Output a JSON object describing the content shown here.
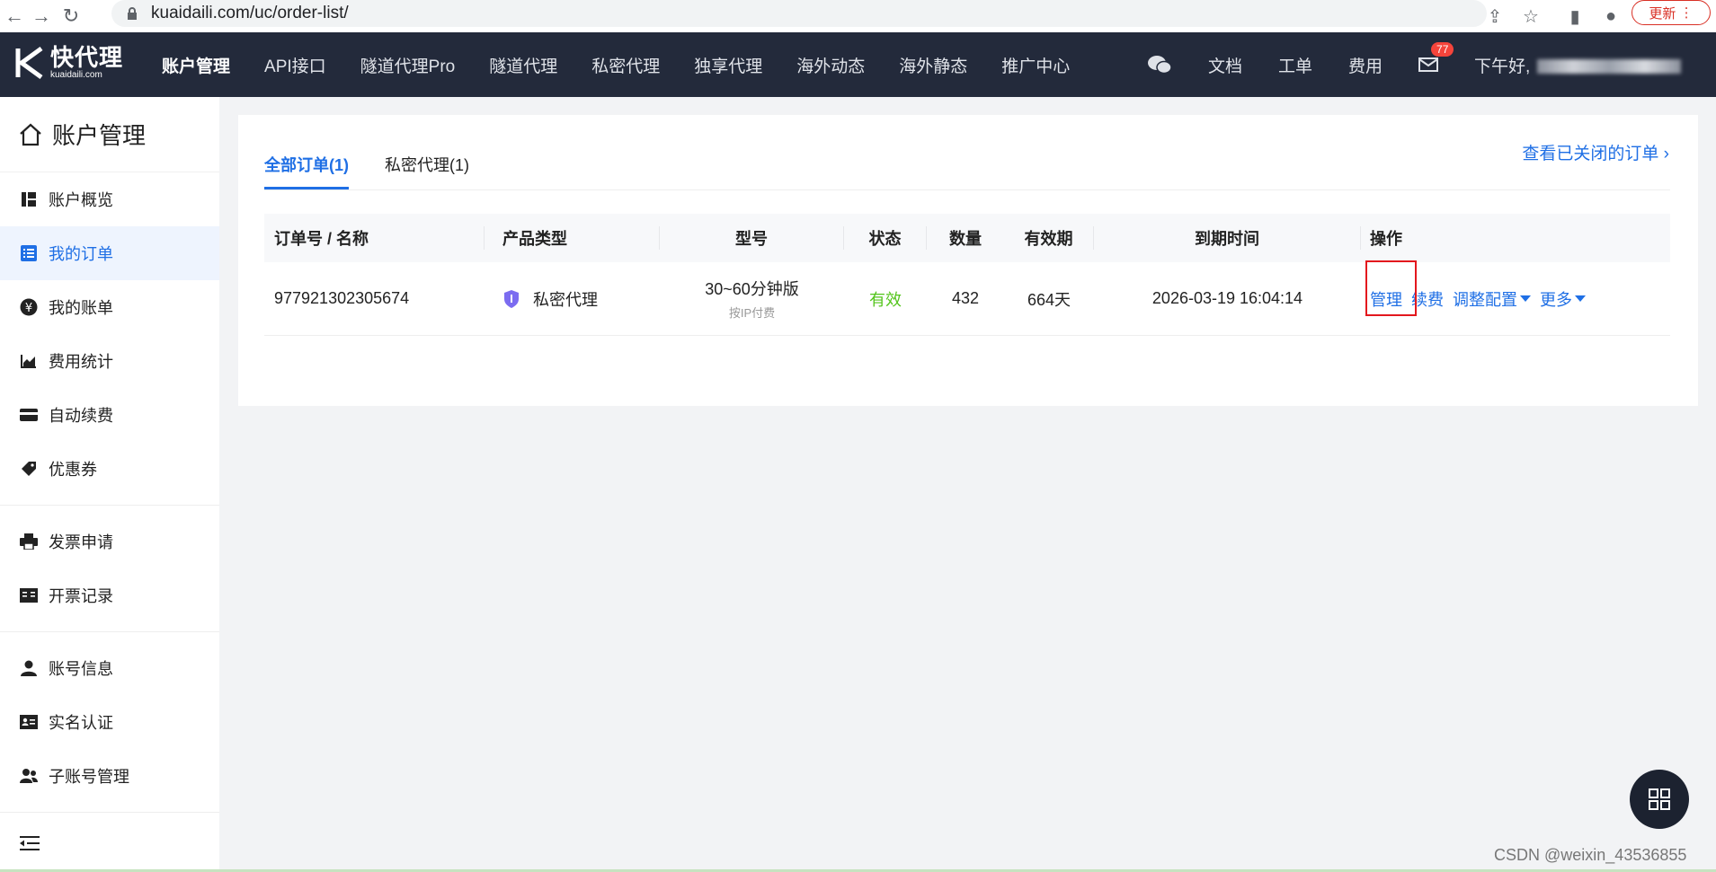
{
  "browser": {
    "url": "kuaidaili.com/uc/order-list/",
    "update_label": "更新"
  },
  "topnav": {
    "logo_main": "快代理",
    "logo_sub": "kuaidaili.com",
    "menu": [
      "账户管理",
      "API接口",
      "隧道代理Pro",
      "隧道代理",
      "私密代理",
      "独享代理",
      "海外动态",
      "海外静态",
      "推广中心"
    ],
    "right_items": [
      "文档",
      "工单",
      "费用"
    ],
    "mail_badge": "77",
    "greeting": "下午好,"
  },
  "sidebar": {
    "title": "账户管理",
    "group1": [
      "账户概览",
      "我的订单",
      "我的账单",
      "费用统计",
      "自动续费",
      "优惠券"
    ],
    "group2": [
      "发票申请",
      "开票记录"
    ],
    "group3": [
      "账号信息",
      "实名认证",
      "子账号管理"
    ],
    "active": "我的订单"
  },
  "content": {
    "tabs": [
      "全部订单(1)",
      "私密代理(1)"
    ],
    "closed_link": "查看已关闭的订单",
    "columns": [
      "订单号 / 名称",
      "产品类型",
      "型号",
      "状态",
      "数量",
      "有效期",
      "到期时间",
      "操作"
    ],
    "row": {
      "order_no": "977921302305674",
      "product": "私密代理",
      "model": "30~60分钟版",
      "model_sub": "按IP付费",
      "status": "有效",
      "quantity": "432",
      "validity": "664天",
      "expire": "2026-03-19 16:04:14",
      "ops": [
        "管理",
        "续费",
        "调整配置",
        "更多"
      ]
    }
  },
  "watermark": "CSDN @weixin_43536855",
  "colors": {
    "nav_bg": "#232a3b",
    "accent": "#1f6fe5",
    "status_ok": "#52c41a",
    "highlight": "#e3171d"
  }
}
